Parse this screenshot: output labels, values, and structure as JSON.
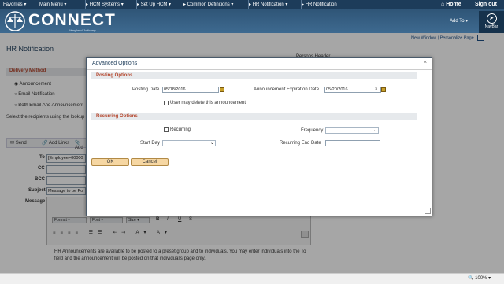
{
  "topnav": {
    "crumbs": [
      "Favorites",
      "Main Menu",
      "HCM Systems",
      "Set Up HCM",
      "Common Definitions",
      "HR Notification",
      "HR Notification"
    ],
    "home_label": "Home",
    "signout_label": "Sign out"
  },
  "header": {
    "logo_text": "CONNECT",
    "logo_sub": "Maryland Judiciary",
    "addto_label": "Add To",
    "navbar_label": "NavBar"
  },
  "links": {
    "new_window": "New Window",
    "personalize_page": "Personalize Page"
  },
  "page": {
    "title": "HR Notification",
    "delivery_method_label": "Delivery Method",
    "options": [
      "Announcement",
      "Email Notification",
      "Both Email And Announcement"
    ],
    "recipients_hint": "Select the recipients using the lookup",
    "toolbar": {
      "send": "Send",
      "add_links": "Add Links",
      "add": "Add"
    },
    "to_label": "To",
    "to_value": "[Employee=00000",
    "cc_label": "CC",
    "bcc_label": "BCC",
    "subject_label": "Subject",
    "subject_value": "Message to be Po",
    "message_label": "Message",
    "rte": {
      "format": "Format",
      "font": "Font",
      "size": "Size"
    },
    "announcement_text": "HR Announcements are available to be posted to a preset group and to individuals. You may enter individuals into the To field and the announcement will be posted on that individual's page only.",
    "background_label": "Persons Header"
  },
  "modal": {
    "title": "Advanced Options",
    "close": "×",
    "posting_section": "Posting Options",
    "posting_date_label": "Posting Date",
    "posting_date_value": "05/18/2016",
    "expiration_label": "Announcement Expiration Date",
    "expiration_value": "05/20/2016",
    "expiration_clear": "×",
    "may_delete_label": "User may delete this announcement",
    "recurring_section": "Recurring Options",
    "recurring_label": "Recurring",
    "frequency_label": "Frequency",
    "start_day_label": "Start Day",
    "recurring_end_label": "Recurring End Date",
    "ok_label": "OK",
    "cancel_label": "Cancel"
  },
  "statusbar": {
    "zoom": "100%"
  }
}
